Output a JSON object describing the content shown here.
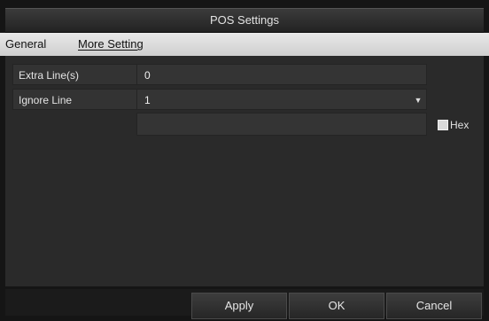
{
  "window": {
    "title": "POS Settings"
  },
  "tabs": [
    {
      "label": "General"
    },
    {
      "label": "More Setting"
    }
  ],
  "fields": [
    {
      "label": "Extra Line(s)",
      "value": "0"
    },
    {
      "label": "Ignore Line",
      "value": "1"
    }
  ],
  "ignore_text": {
    "value": ""
  },
  "hex": {
    "label": "Hex",
    "checked": false
  },
  "buttons": {
    "apply": "Apply",
    "ok": "OK",
    "cancel": "Cancel"
  }
}
